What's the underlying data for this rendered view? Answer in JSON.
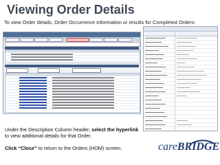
{
  "title": "Viewing Order Details",
  "subtitle": "To view Order details, Order Occurrence information or results for Completed Orders:",
  "instruction": {
    "prefix": "Under the Description Column header, ",
    "strong": "select the hyperlink",
    "suffix": " to view additional details for that Order."
  },
  "close_instruction": {
    "click": "Click",
    "button": "“Close”",
    "rest": " to return to the Orders (HOM) screen."
  },
  "logo": {
    "part1": "care",
    "part2": "BRIDGE"
  },
  "colors": {
    "title": "#3f4a57",
    "logo": "#1f3a6e",
    "header_bar": "#4e6f97"
  }
}
